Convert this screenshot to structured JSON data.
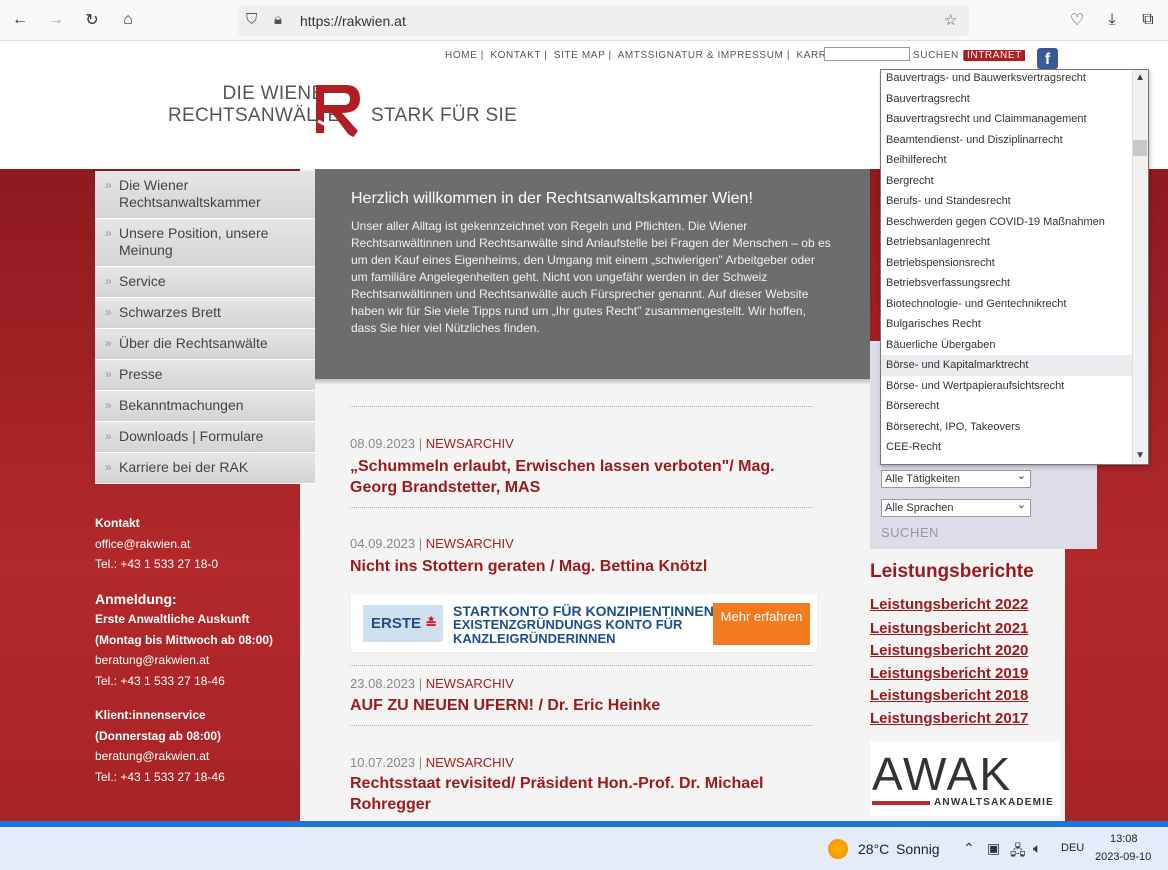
{
  "browser": {
    "url": "https://rakwien.at"
  },
  "header": {
    "top_links": [
      "HOME |",
      "KONTAKT |",
      "SITE MAP |",
      "AMTSSIGNATUR & IMPRESSUM |",
      "KARRIERE"
    ],
    "search_label": "SUCHEN |",
    "intranet": "INTRANET",
    "fb": "f",
    "logo_line1": "DIE WIENER",
    "logo_line2": "RECHTSANWÄLTE",
    "logo_right": "STARK FÜR SIE"
  },
  "sidenav": [
    "Die Wiener Rechtsanwaltskammer",
    "Unsere Position, unsere Meinung",
    "Service",
    "Schwarzes Brett",
    "Über die Rechtsanwälte",
    "Presse",
    "Bekanntmachungen",
    "Downloads | Formulare",
    "Karriere bei der RAK"
  ],
  "contact": {
    "heading": "Kontakt",
    "email": "office@rakwien.at",
    "tel": "Tel.: +43 1 533 27 18-0",
    "anmeldung": "Anmeldung:",
    "auskunft": "Erste Anwaltliche Auskunft",
    "auskunft_time": "(Montag bis Mittwoch ab 08:00)",
    "auskunft_email": "beratung@rakwien.at",
    "auskunft_tel": "Tel.: +43 1 533 27 18-46",
    "service": "Klient:innenservice",
    "service_time": "(Donnerstag ab 08:00)",
    "service_email": "beratung@rakwien.at",
    "service_tel": "Tel.: +43 1 533 27 18-46"
  },
  "welcome": {
    "title": "Herzlich willkommen in der Rechtsanwaltskammer Wien!",
    "text": "Unser aller Alltag ist gekennzeichnet von Regeln und Pflichten. Die Wiener Rechtsanwältinnen und Rechtsanwälte sind Anlaufstelle bei Fragen der Menschen – ob es um den Kauf eines Eigenheims, den Umgang mit einem „schwierigen\" Arbeitgeber oder um familiäre Angelegenheiten geht. Nicht von ungefähr werden in der Schweiz Rechtsanwältinnen und Rechtsanwälte auch Fürsprecher genannt. Auf dieser Website haben wir für Sie viele Tipps rund um „Ihr gutes Recht\" zusammengestellt. Wir hoffen, dass Sie hier viel Nützliches finden."
  },
  "news": [
    {
      "date": "08.09.2023",
      "sep": "|",
      "cat": "NEWSARCHIV",
      "title": "„Schummeln erlaubt, Erwischen lassen verboten\"/ Mag. Georg Brandstetter, MAS"
    },
    {
      "date": "04.09.2023",
      "sep": "|",
      "cat": "NEWSARCHIV",
      "title": "Nicht ins Stottern geraten / Mag. Bettina Knötzl"
    },
    {
      "date": "23.08.2023",
      "sep": "|",
      "cat": "NEWSARCHIV",
      "title": "AUF ZU NEUEN UFERN! / Dr. Eric Heinke"
    },
    {
      "date": "10.07.2023",
      "sep": "|",
      "cat": "NEWSARCHIV",
      "title": "Rechtsstaat revisited/ Präsident Hon.-Prof. Dr. Michael Rohregger"
    }
  ],
  "banner": {
    "brand": "ERSTE",
    "brand_mark": "≛",
    "line1": "STARTKONTO FÜR KONZIPIENTINNEN",
    "line2": "EXISTENZGRÜNDUNGS KONTO FÜR",
    "line3": "KANZLEIGRÜNDERINNEN",
    "cta": "Mehr erfahren"
  },
  "search": {
    "select_taetigkeit": "Alle Tätigkeiten",
    "select_sprache": "Alle Sprachen",
    "button": "SUCHEN"
  },
  "leistungsberichte": {
    "title": "Leistungsberichte",
    "items": [
      "Leistungsbericht 2022",
      "Leistungsbericht 2021",
      "Leistungsbericht 2020",
      "Leistungsbericht 2019",
      "Leistungsbericht 2018",
      "Leistungsbericht 2017"
    ]
  },
  "awak": {
    "word": "AWAK",
    "sub": "ANWALTSAKADEMIE"
  },
  "dropdown": {
    "items": [
      "Bauvertrags- und Bauwerksvertragsrecht",
      "Bauvertragsrecht",
      "Bauvertragsrecht und Claimmanagement",
      "Beamtendienst- und Disziplinarrecht",
      "Beihilferecht",
      "Bergrecht",
      "Berufs- und Standesrecht",
      "Beschwerden gegen COVID-19 Maßnahmen",
      "Betriebsanlagenrecht",
      "Betriebspensionsrecht",
      "Betriebsverfassungsrecht",
      "Biotechnologie- und Gentechnikrecht",
      "Bulgarisches Recht",
      "Bäuerliche Übergaben",
      "Börse- und Kapitalmarktrecht",
      "Börse- und Wertpapieraufsichtsrecht",
      "Börserecht",
      "Börserecht, IPO, Takeovers",
      "CEE-Recht"
    ],
    "highlighted_index": 14
  },
  "taskbar": {
    "temp": "28°C",
    "condition": "Sonnig",
    "lang": "DEU",
    "time": "13:08",
    "date": "2023-09-10"
  }
}
